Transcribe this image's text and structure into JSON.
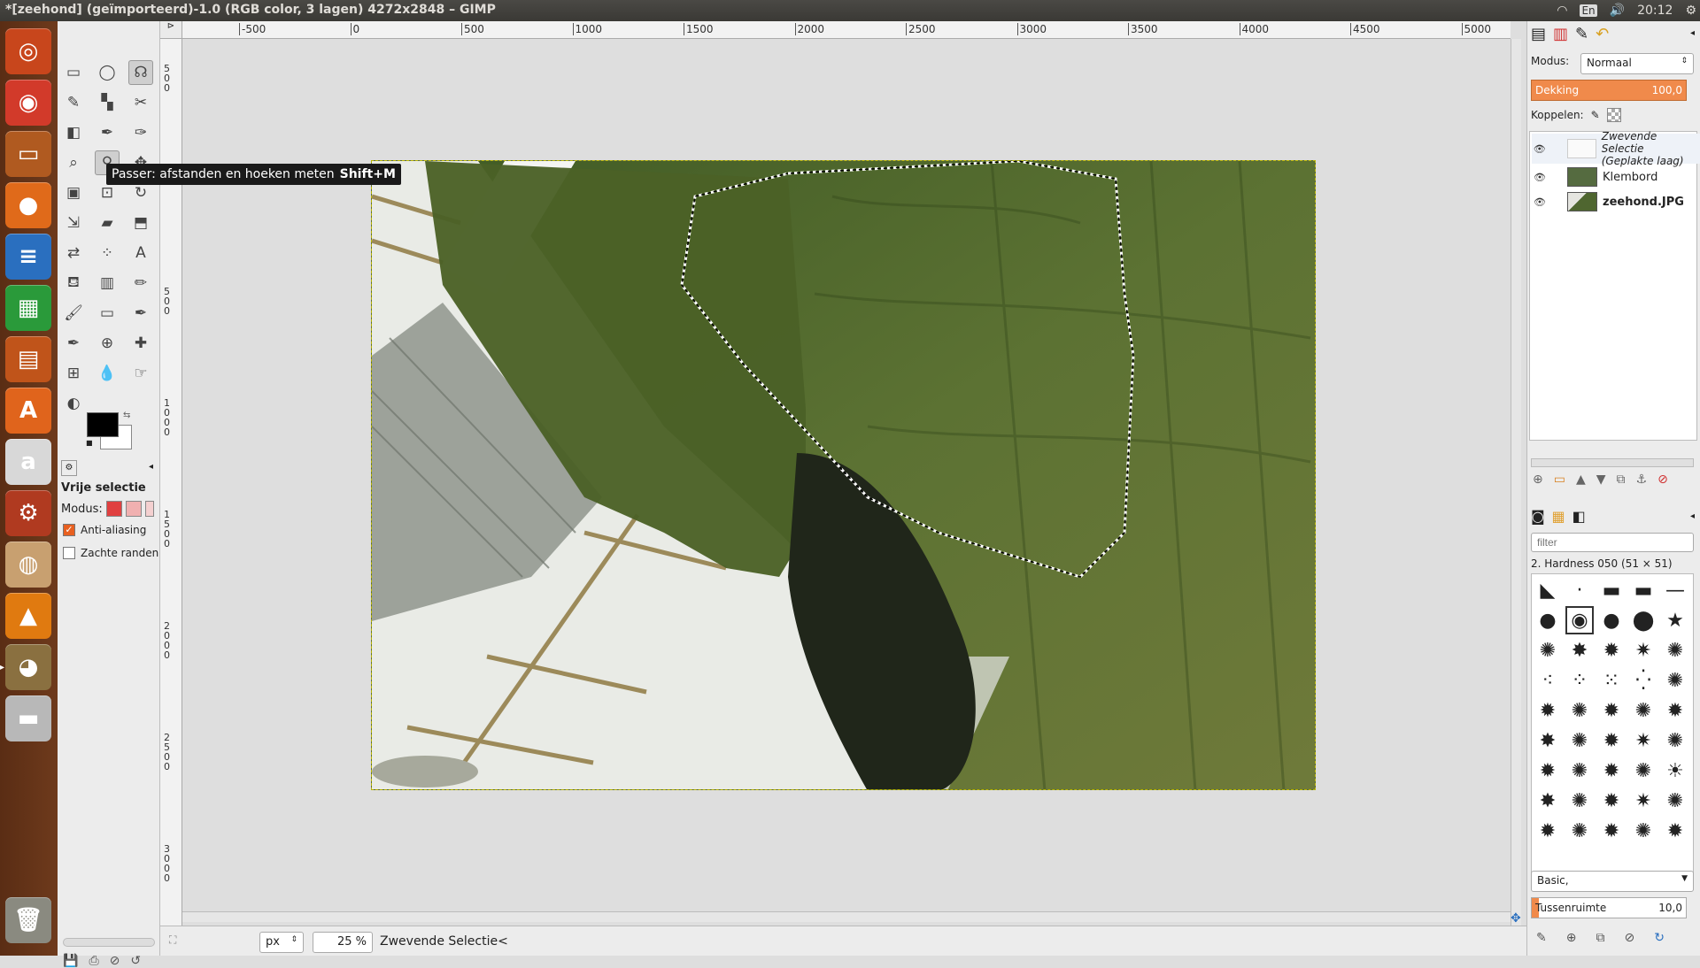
{
  "window": {
    "title": "*[zeehond] (geïmporteerd)-1.0 (RGB color, 3 lagen) 4272x2848 – GIMP"
  },
  "tray": {
    "keyboard_layout": "En",
    "time": "20:12"
  },
  "launcher": {
    "items": [
      {
        "name": "ubuntu-dash-icon",
        "color": "#c8461c",
        "glyph": "◎"
      },
      {
        "name": "chrome-icon",
        "color": "#d23a2a",
        "glyph": "◉"
      },
      {
        "name": "files-icon",
        "color": "#b05a20",
        "glyph": "▭"
      },
      {
        "name": "firefox-icon",
        "color": "#e06a1a",
        "glyph": "●"
      },
      {
        "name": "writer-icon",
        "color": "#2a6fbf",
        "glyph": "≡"
      },
      {
        "name": "calc-icon",
        "color": "#2a9a3a",
        "glyph": "▦"
      },
      {
        "name": "impress-icon",
        "color": "#c0541a",
        "glyph": "▤"
      },
      {
        "name": "software-center-icon",
        "color": "#e0641c",
        "glyph": "A"
      },
      {
        "name": "amazon-icon",
        "color": "#d8d8d8",
        "glyph": "a"
      },
      {
        "name": "settings-icon",
        "color": "#b03a20",
        "glyph": "⚙"
      },
      {
        "name": "debian-icon",
        "color": "#c8a070",
        "glyph": "◍"
      },
      {
        "name": "vlc-icon",
        "color": "#e07a10",
        "glyph": "▲"
      },
      {
        "name": "gimp-icon",
        "color": "#8a7040",
        "glyph": "◕"
      },
      {
        "name": "drive-icon",
        "color": "#b8b8b8",
        "glyph": "▬"
      }
    ],
    "trash": {
      "name": "trash-icon",
      "glyph": "🗑"
    }
  },
  "toolbox": {
    "tools": [
      "rect-select-icon",
      "ellipse-select-icon",
      "free-select-icon",
      "fuzzy-select-icon",
      "color-select-icon",
      "scissors-icon",
      "foreground-select-icon",
      "paths-icon",
      "color-picker-icon",
      "zoom-icon",
      "measure-icon",
      "move-icon",
      "align-icon",
      "crop-icon",
      "rotate-icon",
      "scale-icon",
      "shear-icon",
      "perspective-icon",
      "flip-icon",
      "cage-icon",
      "text-icon",
      "bucket-fill-icon",
      "blend-icon",
      "pencil-icon",
      "paintbrush-icon",
      "eraser-icon",
      "airbrush-icon",
      "ink-icon",
      "clone-icon",
      "heal-icon",
      "perspective-clone-icon",
      "blur-icon",
      "smudge-icon",
      "dodge-burn-icon"
    ],
    "tool_glyphs": [
      "▭",
      "◯",
      "☊",
      "✎",
      "▚",
      "✂",
      "◧",
      "✒",
      "✑",
      "⌕",
      "⚲",
      "✥",
      "▣",
      "⊡",
      "↻",
      "⇲",
      "▰",
      "⬒",
      "⇄",
      "⁘",
      "A",
      "⛾",
      "▥",
      "✏",
      "🖌",
      "▭",
      "✒",
      "✒",
      "⊕",
      "✚",
      "⊞",
      "💧",
      "☞",
      "◐"
    ],
    "colors": {
      "foreground": "#000000",
      "background": "#ffffff"
    },
    "options_title": "Vrije selectie",
    "mode_label": "Modus:",
    "antialias_label": "Anti-aliasing",
    "antialias_checked": true,
    "feather_label": "Zachte randen",
    "feather_checked": false
  },
  "tooltip": {
    "text": "Passer: afstanden en hoeken meten",
    "shortcut": "Shift+M"
  },
  "ruler": {
    "top_labels": [
      "-500",
      "0",
      "500",
      "1000",
      "1500",
      "2000",
      "2500",
      "3000",
      "3500",
      "4000",
      "4500",
      "5000"
    ],
    "left_labels": [
      "5\n0\n0",
      "0",
      "5\n0\n0",
      "1\n0\n0\n0",
      "1\n5\n0\n0",
      "2\n0\n0\n0",
      "2\n5\n0\n0",
      "3\n0\n0\n0"
    ]
  },
  "statusbar": {
    "unit": "px",
    "zoom": "25 %",
    "message": "Zwevende Selectie<"
  },
  "layers_panel": {
    "mode_label": "Modus:",
    "mode_value": "Normaal",
    "opacity_label": "Dekking",
    "opacity_value": "100,0",
    "lock_label": "Koppelen:",
    "layers": [
      {
        "name": "Zwevende Selectie",
        "sub": "(Geplakte laag)",
        "italic": true
      },
      {
        "name": "Klembord",
        "sub": "",
        "italic": false
      },
      {
        "name": "zeehond.JPG",
        "sub": "",
        "italic": false
      }
    ]
  },
  "brushes_panel": {
    "filter_placeholder": "filter",
    "brush_title": "2. Hardness 050 (51 × 51)",
    "preset": "Basic,",
    "spacing_label": "Tussenruimte",
    "spacing_value": "10,0"
  },
  "accent": "#f08a4b"
}
